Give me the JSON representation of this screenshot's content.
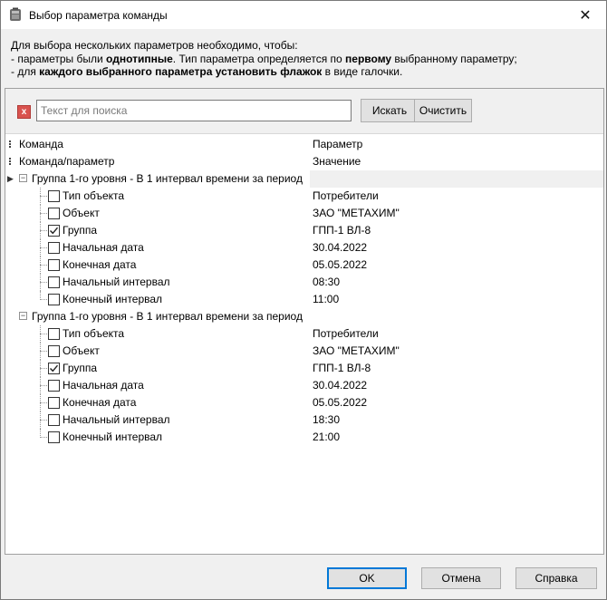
{
  "window": {
    "title": "Выбор параметра команды",
    "close_glyph": "✕"
  },
  "info": {
    "line1": "Для выбора нескольких параметров необходимо, чтобы:",
    "line2_pre": "- параметры были ",
    "line2_bold1": "однотипные",
    "line2_mid": ". Тип параметра определяется по ",
    "line2_bold2": "первому",
    "line2_post": " выбранному параметру;",
    "line3_pre": "- для ",
    "line3_bold": "каждого выбранного параметра установить флажок",
    "line3_post": " в виде галочки."
  },
  "search": {
    "clear_glyph": "x",
    "placeholder": "Текст для поиска",
    "value": "",
    "search_label": "Искать",
    "reset_label": "Очистить"
  },
  "grid": {
    "header1": {
      "col1": "Команда",
      "col2": "Параметр"
    },
    "header2": {
      "col1": "Команда/параметр",
      "col2": "Значение"
    },
    "groups": [
      {
        "label": "Группа 1-го уровня - В 1 интервал времени за период",
        "expander": "−",
        "items": [
          {
            "name": "Тип объекта",
            "value": "Потребители",
            "checked": false
          },
          {
            "name": "Объект",
            "value": "ЗАО \"МЕТАХИМ\"",
            "checked": false
          },
          {
            "name": "Группа",
            "value": "ГПП-1 ВЛ-8",
            "checked": true
          },
          {
            "name": "Начальная дата",
            "value": "30.04.2022",
            "checked": false
          },
          {
            "name": "Конечная дата",
            "value": "05.05.2022",
            "checked": false
          },
          {
            "name": "Начальный интервал",
            "value": "08:30",
            "checked": false
          },
          {
            "name": "Конечный интервал",
            "value": "11:00",
            "checked": false
          }
        ]
      },
      {
        "label": "Группа 1-го уровня - В 1 интервал времени за период",
        "expander": "−",
        "items": [
          {
            "name": "Тип объекта",
            "value": "Потребители",
            "checked": false
          },
          {
            "name": "Объект",
            "value": "ЗАО \"МЕТАХИМ\"",
            "checked": false
          },
          {
            "name": "Группа",
            "value": "ГПП-1 ВЛ-8",
            "checked": true
          },
          {
            "name": "Начальная дата",
            "value": "30.04.2022",
            "checked": false
          },
          {
            "name": "Конечная дата",
            "value": "05.05.2022",
            "checked": false
          },
          {
            "name": "Начальный интервал",
            "value": "18:30",
            "checked": false
          },
          {
            "name": "Конечный интервал",
            "value": "21:00",
            "checked": false
          }
        ]
      }
    ]
  },
  "footer": {
    "ok_label": "OK",
    "cancel_label": "Отмена",
    "help_label": "Справка"
  },
  "colors": {
    "accent": "#0078d7",
    "clear_button": "#d9534f",
    "selected_row": "#f0f0f0"
  }
}
